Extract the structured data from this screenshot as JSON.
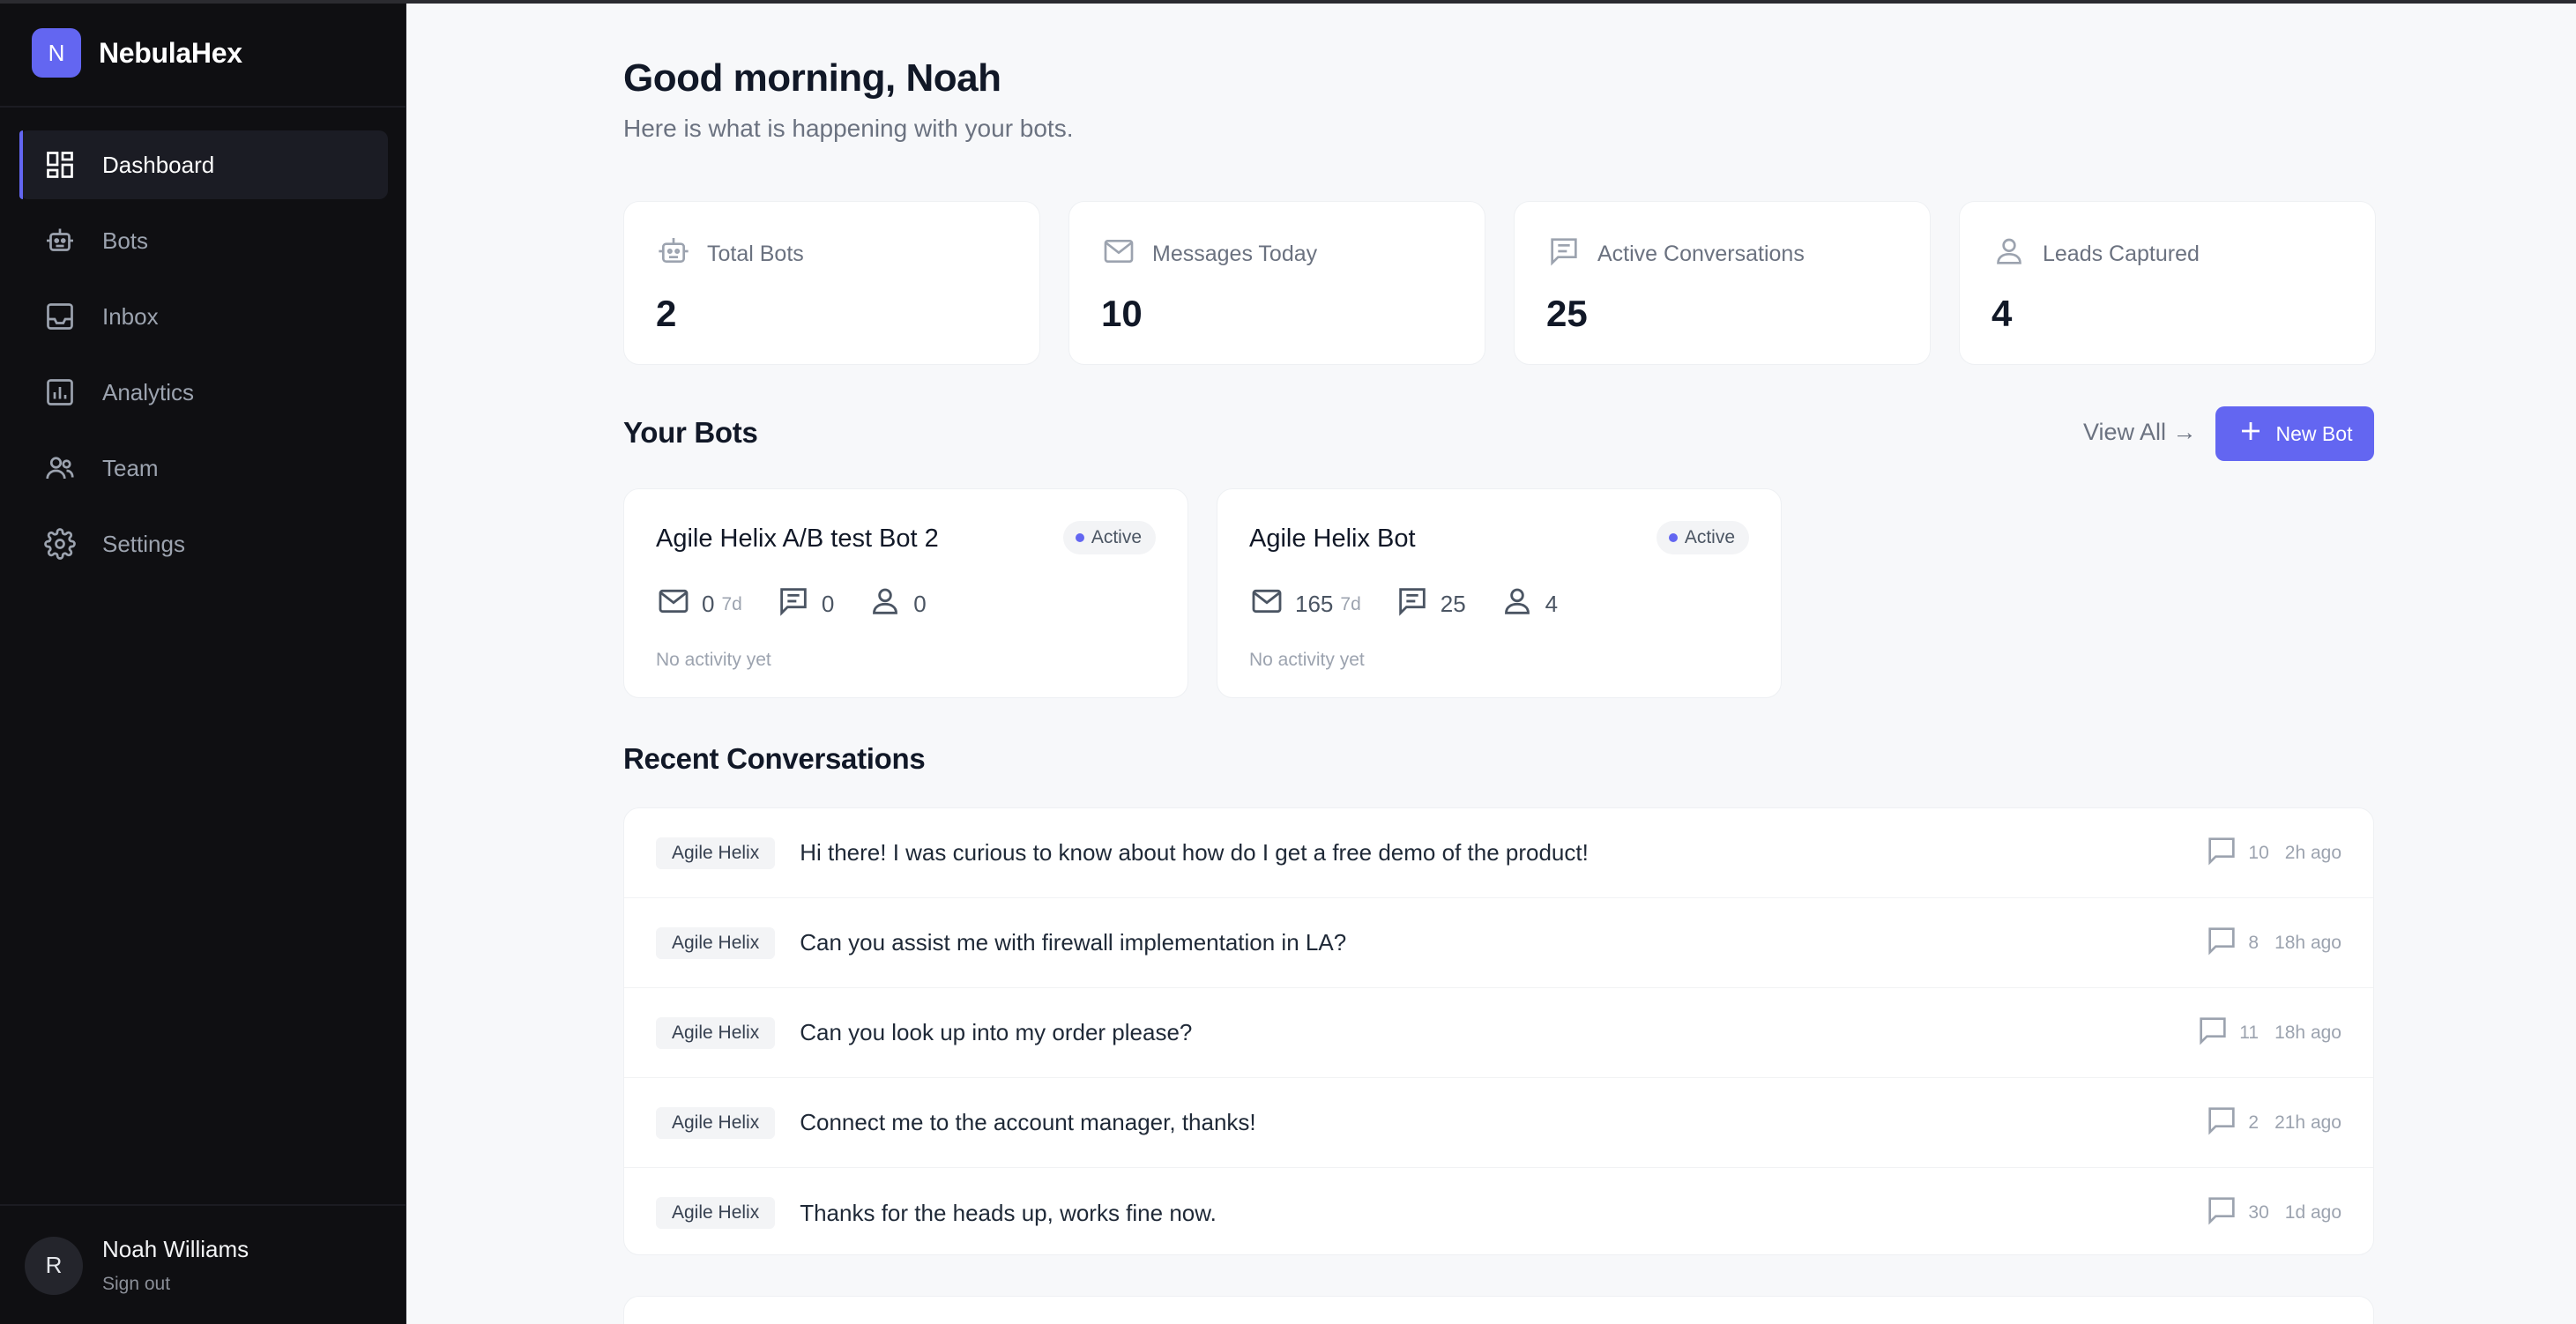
{
  "brand": {
    "logo_letter": "N",
    "name": "NebulaHex",
    "accent_color": "#6366f1"
  },
  "nav": {
    "items": [
      {
        "label": "Dashboard",
        "icon": "dashboard-icon",
        "active": true
      },
      {
        "label": "Bots",
        "icon": "robot-icon"
      },
      {
        "label": "Inbox",
        "icon": "inbox-icon"
      },
      {
        "label": "Analytics",
        "icon": "analytics-icon"
      },
      {
        "label": "Team",
        "icon": "team-icon"
      },
      {
        "label": "Settings",
        "icon": "gear-icon"
      }
    ]
  },
  "user": {
    "initial": "R",
    "name": "Noah Williams",
    "sign_out": "Sign out"
  },
  "header": {
    "greeting": "Good morning, Noah",
    "subtitle": "Here is what is happening with your bots."
  },
  "stats": [
    {
      "label": "Total Bots",
      "value": "2",
      "icon": "robot-icon"
    },
    {
      "label": "Messages Today",
      "value": "10",
      "icon": "mail-icon"
    },
    {
      "label": "Active Conversations",
      "value": "25",
      "icon": "chat-icon"
    },
    {
      "label": "Leads Captured",
      "value": "4",
      "icon": "person-icon"
    }
  ],
  "bots_section": {
    "title": "Your Bots",
    "view_all": "View All →",
    "new_bot": "New Bot"
  },
  "bots": [
    {
      "name": "Agile Helix A/B test Bot 2",
      "status": "Active",
      "messages": "0",
      "period": "7d",
      "conversations": "0",
      "leads": "0",
      "activity": "No activity yet"
    },
    {
      "name": "Agile Helix Bot",
      "status": "Active",
      "messages": "165",
      "period": "7d",
      "conversations": "25",
      "leads": "4",
      "activity": "No activity yet"
    }
  ],
  "recent": {
    "title": "Recent Conversations",
    "rows": [
      {
        "bot": "Agile Helix",
        "text": "Hi there! I was curious to know about how do I get a free demo of the product!",
        "count": "10",
        "time": "2h ago"
      },
      {
        "bot": "Agile Helix",
        "text": "Can you assist me with firewall implementation in LA?",
        "count": "8",
        "time": "18h ago"
      },
      {
        "bot": "Agile Helix",
        "text": "Can you look up into my order please?",
        "count": "11",
        "time": "18h ago"
      },
      {
        "bot": "Agile Helix",
        "text": "Connect me to the account manager, thanks!",
        "count": "2",
        "time": "21h ago"
      },
      {
        "bot": "Agile Helix",
        "text": "Thanks for the heads up, works fine now.",
        "count": "30",
        "time": "1d ago"
      }
    ]
  }
}
